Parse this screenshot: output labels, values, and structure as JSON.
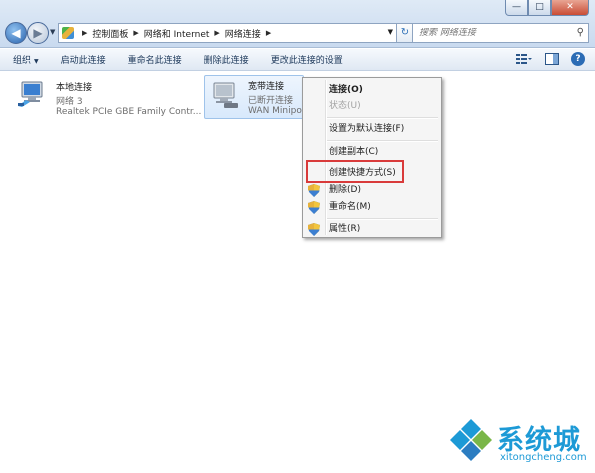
{
  "window": {
    "minimize_glyph": "—",
    "maximize_glyph": "□",
    "close_glyph": "✕"
  },
  "address_bar": {
    "crumbs": [
      "控制面板",
      "网络和 Internet",
      "网络连接"
    ],
    "search_placeholder": "搜索 网络连接"
  },
  "toolbar": {
    "organize_label": "组织",
    "start_label": "启动此连接",
    "rename_label": "重命名此连接",
    "delete_label": "删除此连接",
    "change_settings_label": "更改此连接的设置",
    "help_label": "?"
  },
  "connections": [
    {
      "name": "本地连接",
      "status": "网络  3",
      "device": "Realtek PCIe GBE Family Contr..."
    },
    {
      "name": "宽带连接",
      "status": "已断开连接",
      "device": "WAN Minipo"
    }
  ],
  "context_menu": {
    "items": [
      {
        "label": "连接(O)"
      },
      {
        "label": "状态(U)"
      },
      {
        "label": "设置为默认连接(F)"
      },
      {
        "label": "创建副本(C)"
      },
      {
        "label": "创建快捷方式(S)"
      },
      {
        "label": "删除(D)"
      },
      {
        "label": "重命名(M)"
      },
      {
        "label": "属性(R)"
      }
    ]
  },
  "watermark": {
    "brand": "系统城",
    "url": "xitongcheng.com"
  },
  "colors": {
    "accent": "#1d9ad6",
    "highlight_border": "#d93b3b",
    "selection_bg": "#d8e9fc"
  },
  "icons": [
    "back-arrow-icon",
    "forward-arrow-icon",
    "folder-icon",
    "refresh-icon",
    "search-icon",
    "computer-icon",
    "shield-icon",
    "layout-icon",
    "help-icon"
  ]
}
